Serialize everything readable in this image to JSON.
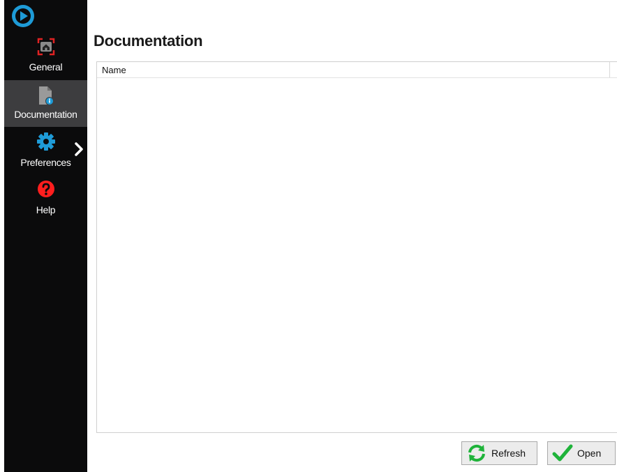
{
  "page": {
    "title": "Documentation"
  },
  "sidebar": {
    "items": [
      {
        "id": "general",
        "label": "General",
        "icon": "home-frame-icon",
        "active": false
      },
      {
        "id": "documentation",
        "label": "Documentation",
        "icon": "document-info-icon",
        "active": true
      },
      {
        "id": "preferences",
        "label": "Preferences",
        "icon": "gear-icon",
        "active": false
      },
      {
        "id": "help",
        "label": "Help",
        "icon": "question-icon",
        "active": false
      }
    ]
  },
  "list": {
    "columns": [
      {
        "label": "Name"
      }
    ],
    "rows": []
  },
  "buttons": {
    "refresh_label": "Refresh",
    "open_label": "Open"
  },
  "colors": {
    "sidebar_bg": "#0b0b0c",
    "active_item_bg": "#3d3d3f",
    "accent_blue": "#1e9bd7",
    "general_red": "#e02222",
    "help_red": "#ff1e1e",
    "button_green": "#1fb33a"
  }
}
